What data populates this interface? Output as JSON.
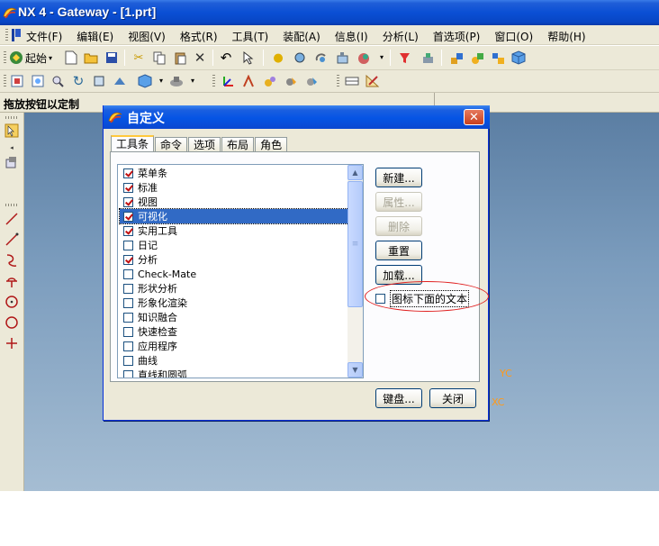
{
  "window": {
    "title": "NX 4 - Gateway - [1.prt]"
  },
  "menu": {
    "items": [
      "文件(F)",
      "编辑(E)",
      "视图(V)",
      "格式(R)",
      "工具(T)",
      "装配(A)",
      "信息(I)",
      "分析(L)",
      "首选项(P)",
      "窗口(O)",
      "帮助(H)"
    ]
  },
  "toolbar": {
    "start_label": "起始"
  },
  "cue_line": {
    "text": "拖放按钮以定制"
  },
  "axes": {
    "yc": "YC",
    "xc": "XC"
  },
  "dialog": {
    "title": "自定义",
    "close_glyph": "✕",
    "tabs": [
      "工具条",
      "命令",
      "选项",
      "布局",
      "角色"
    ],
    "active_tab": "工具条",
    "toolbars": [
      {
        "label": "菜单条",
        "checked": true
      },
      {
        "label": "标准",
        "checked": true
      },
      {
        "label": "视图",
        "checked": true
      },
      {
        "label": "可视化",
        "checked": true,
        "selected": true
      },
      {
        "label": "实用工具",
        "checked": true
      },
      {
        "label": "日记",
        "checked": false
      },
      {
        "label": "分析",
        "checked": true
      },
      {
        "label": "Check-Mate",
        "checked": false
      },
      {
        "label": "形状分析",
        "checked": false
      },
      {
        "label": "形象化渲染",
        "checked": false
      },
      {
        "label": "知识融合",
        "checked": false
      },
      {
        "label": "快速检查",
        "checked": false
      },
      {
        "label": "应用程序",
        "checked": false
      },
      {
        "label": "曲线",
        "checked": false
      },
      {
        "label": "直线和圆弧",
        "checked": false
      }
    ],
    "buttons": {
      "new": "新建...",
      "properties": "属性...",
      "delete": "删除",
      "reset": "重置",
      "load": "加载...",
      "keyboard": "键盘...",
      "close": "关闭"
    },
    "icon_text_option": {
      "label": "图标下面的文本",
      "checked": false
    }
  },
  "colors": {
    "titlebar": "#0a4fd4",
    "face": "#ece9d8",
    "graphics_top": "#5b7ea3",
    "graphics_bottom": "#a5bdd3",
    "axis": "#ff9a1a",
    "selection": "#316ac5",
    "annotation": "#e02020"
  }
}
